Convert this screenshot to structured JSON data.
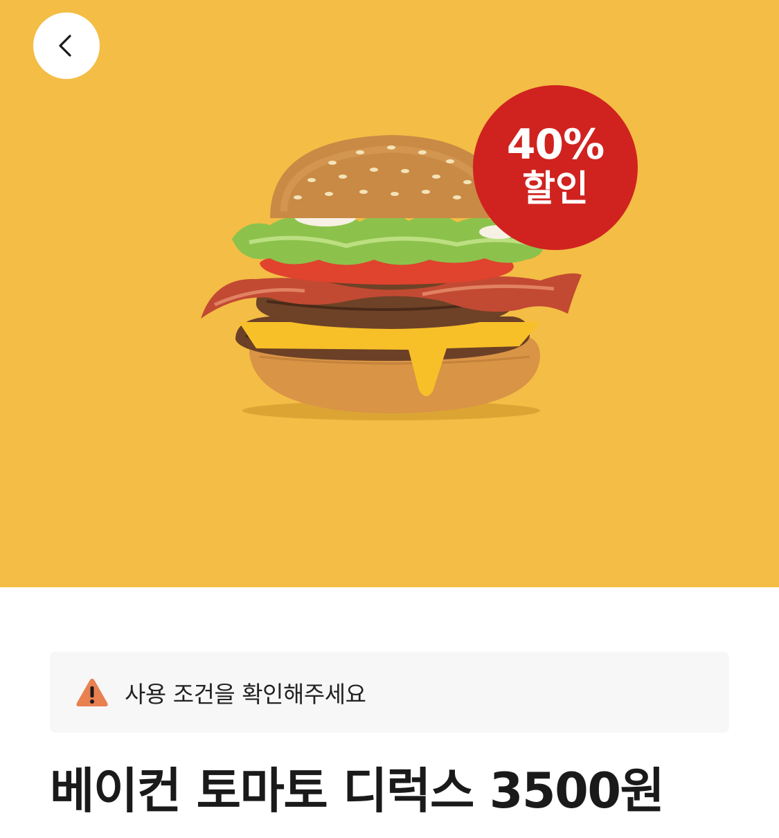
{
  "header": {
    "back_icon": "chevron-left-icon"
  },
  "hero": {
    "background_color": "#F4BD45",
    "image": "burger-image"
  },
  "badge": {
    "percent": "40%",
    "label": "할인",
    "color": "#D0231F"
  },
  "notice": {
    "icon": "warning-icon",
    "icon_color": "#E8804F",
    "text": "사용 조건을 확인해주세요"
  },
  "product": {
    "title": "베이컨 토마토 디럭스 3500원"
  }
}
